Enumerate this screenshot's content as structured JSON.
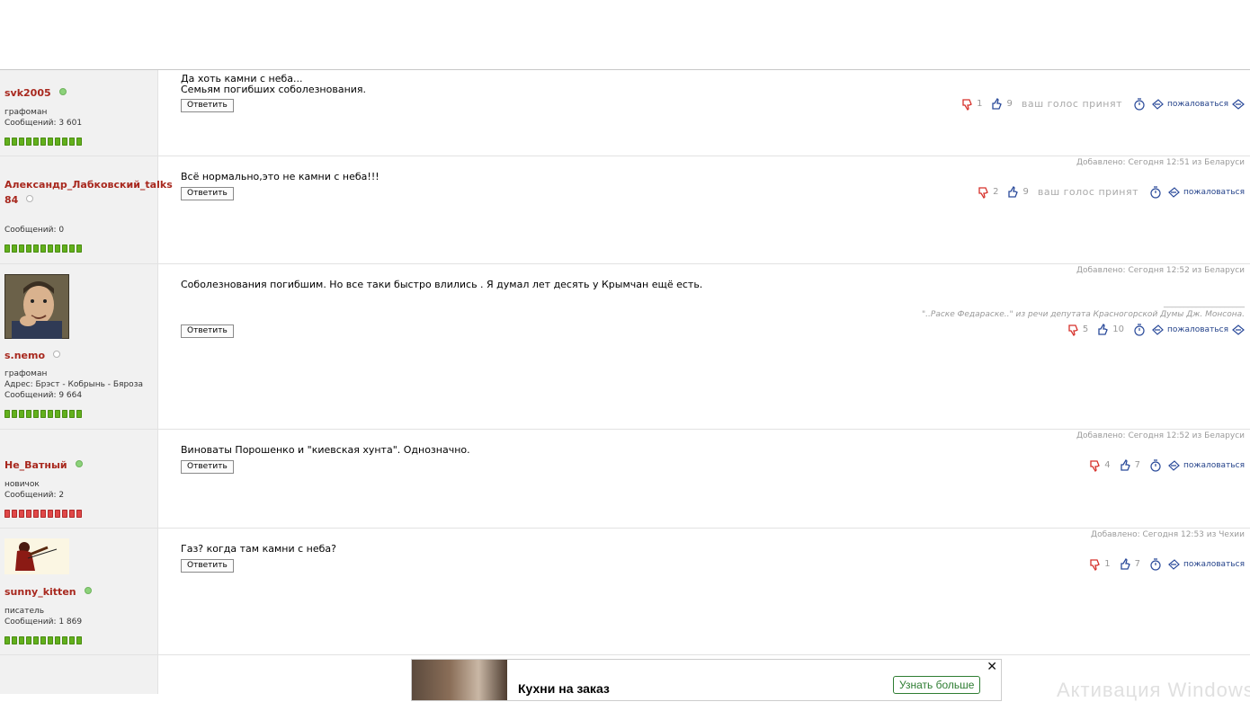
{
  "common": {
    "reply_label": "Ответить",
    "complain_label": "пожаловаться",
    "vote_accepted": "ваш голос принят"
  },
  "posts": [
    {
      "user": {
        "name": "svk2005",
        "status": "графоман",
        "messages": "Сообщений: 3 601",
        "online": true,
        "rep": "green"
      },
      "text": [
        "Да хоть камни с неба...",
        "Семьям погибших соболезнования."
      ],
      "down": "1",
      "up": "9",
      "voted": true,
      "added": ""
    },
    {
      "user": {
        "name": "Александр_Лабковский_talks",
        "name2": "84",
        "status": "",
        "messages": "Сообщений: 0",
        "online": false,
        "rep": "green"
      },
      "text": [
        "Всё нормально,это не камни с неба!!!"
      ],
      "down": "2",
      "up": "9",
      "voted": true,
      "added": "Добавлено: Сегодня 12:51 из Беларуси"
    },
    {
      "user": {
        "name": "s.nemo",
        "status": "графоман",
        "address": "Адрес: Брэст - Кобрынь - Бяроза",
        "messages": "Сообщений: 9 664",
        "online": false,
        "rep": "green"
      },
      "text": [
        "Соболезнования погибшим. Но все таки быстро влились . Я думал лет десять у Крымчан ещё есть."
      ],
      "signature_line": "____________________",
      "signature": "\"..Раске Федараске..\" из речи депутата Красногорской Думы Дж. Монсона.",
      "down": "5",
      "up": "10",
      "voted": false,
      "added": "Добавлено: Сегодня 12:52 из Беларуси"
    },
    {
      "user": {
        "name": "Не_Ватный",
        "status": "новичок",
        "messages": "Сообщений: 2",
        "online": true,
        "rep": "red"
      },
      "text": [
        "Виноваты Порошенко и \"киевская хунта\". Однозначно."
      ],
      "down": "4",
      "up": "7",
      "voted": false,
      "added": "Добавлено: Сегодня 12:52 из Беларуси"
    },
    {
      "user": {
        "name": "sunny_kitten",
        "status": "писатель",
        "messages": "Сообщений: 1 869",
        "online": true,
        "rep": "green"
      },
      "text": [
        "Газ? когда там камни с неба?"
      ],
      "down": "1",
      "up": "7",
      "voted": false,
      "added": "Добавлено: Сегодня 12:53 из Чехии"
    }
  ],
  "ad": {
    "title": "Кухни на заказ",
    "button": "Узнать больше",
    "close": "✕"
  },
  "watermark": "Активация Windows",
  "colors": {
    "username": "#a8281e",
    "rep_green": "#62b01c",
    "rep_red": "#e04848",
    "complain": "#24428a"
  }
}
